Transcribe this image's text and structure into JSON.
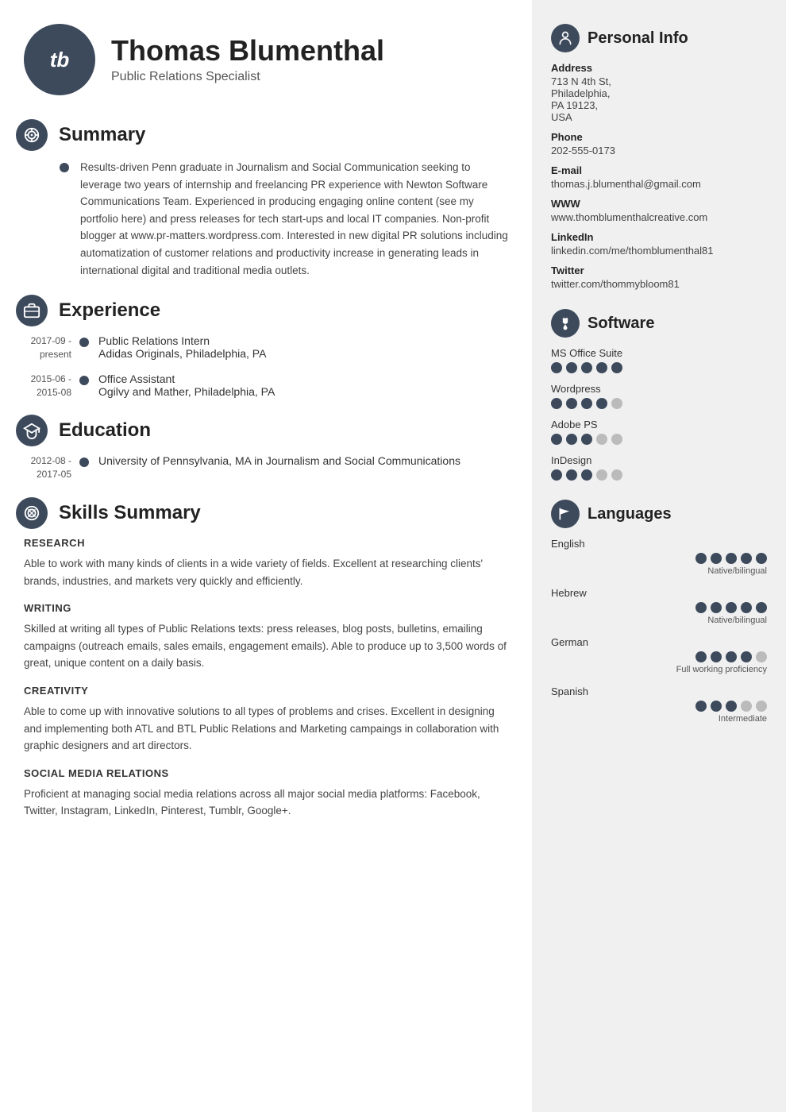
{
  "header": {
    "initials": "tb",
    "name": "Thomas Blumenthal",
    "subtitle": "Public Relations Specialist"
  },
  "summary": {
    "title": "Summary",
    "text": "Results-driven Penn graduate in Journalism and Social Communication seeking to leverage two years of internship and freelancing PR experience with Newton Software Communications Team. Experienced in producing engaging online content (see my portfolio here) and press releases for tech start-ups and local IT companies. Non-profit blogger at www.pr-matters.wordpress.com. Interested in new digital PR solutions including automatization of customer relations and productivity increase in generating leads in international digital and traditional media outlets."
  },
  "experience": {
    "title": "Experience",
    "items": [
      {
        "date": "2017-09 -\npresent",
        "title": "Public Relations Intern",
        "sub": "Adidas Originals, Philadelphia, PA"
      },
      {
        "date": "2015-06 -\n2015-08",
        "title": "Office Assistant",
        "sub": "Ogilvy and Mather, Philadelphia, PA"
      }
    ]
  },
  "education": {
    "title": "Education",
    "items": [
      {
        "date": "2012-08 -\n2017-05",
        "title": "University of Pennsylvania, MA in Journalism and Social Communications",
        "sub": ""
      }
    ]
  },
  "skills": {
    "title": "Skills Summary",
    "categories": [
      {
        "name": "RESEARCH",
        "text": "Able to work with many kinds of clients in a wide variety of fields. Excellent at researching clients' brands, industries, and markets very quickly and efficiently."
      },
      {
        "name": "WRITING",
        "text": "Skilled at writing all types of Public Relations texts: press releases, blog posts, bulletins, emailing campaigns (outreach emails, sales emails, engagement emails). Able to produce up to 3,500 words of great, unique content on a daily basis."
      },
      {
        "name": "CREATIVITY",
        "text": "Able to come up with innovative solutions to all types of problems and crises. Excellent in designing and implementing both ATL and BTL Public Relations and Marketing campaings in collaboration with graphic designers and art directors."
      },
      {
        "name": "SOCIAL MEDIA RELATIONS",
        "text": "Proficient at managing social media relations across all major social media platforms: Facebook, Twitter, Instagram, LinkedIn, Pinterest, Tumblr, Google+."
      }
    ]
  },
  "sidebar": {
    "personal_info": {
      "title": "Personal Info",
      "fields": [
        {
          "label": "Address",
          "value": "713 N 4th St,\nPhiladelphia,\nPA 19123,\nUSA"
        },
        {
          "label": "Phone",
          "value": "202-555-0173"
        },
        {
          "label": "E-mail",
          "value": "thomas.j.blumenthal@gmail.com"
        },
        {
          "label": "WWW",
          "value": "www.thomblumenthalcreative.com"
        },
        {
          "label": "LinkedIn",
          "value": "linkedin.com/me/thomblumenthal81"
        },
        {
          "label": "Twitter",
          "value": "twitter.com/thommybloom81"
        }
      ]
    },
    "software": {
      "title": "Software",
      "items": [
        {
          "name": "MS Office Suite",
          "filled": 5,
          "total": 5
        },
        {
          "name": "Wordpress",
          "filled": 4,
          "total": 5
        },
        {
          "name": "Adobe PS",
          "filled": 3,
          "total": 5
        },
        {
          "name": "InDesign",
          "filled": 3,
          "total": 5
        }
      ]
    },
    "languages": {
      "title": "Languages",
      "items": [
        {
          "name": "English",
          "filled": 5,
          "total": 5,
          "level": "Native/bilingual"
        },
        {
          "name": "Hebrew",
          "filled": 5,
          "total": 5,
          "level": "Native/bilingual"
        },
        {
          "name": "German",
          "filled": 4,
          "total": 5,
          "level": "Full working proficiency"
        },
        {
          "name": "Spanish",
          "filled": 3,
          "total": 5,
          "level": "Intermediate"
        }
      ]
    }
  }
}
